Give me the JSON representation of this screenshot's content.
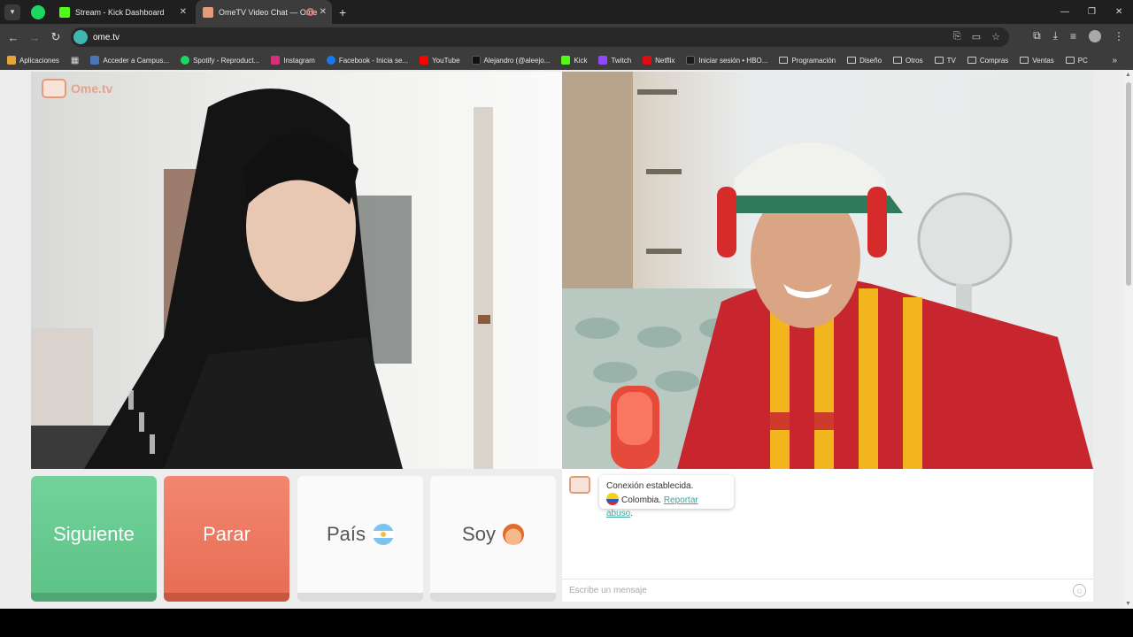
{
  "browser": {
    "tabs": [
      {
        "title": "Stream - Kick Dashboard",
        "icon": "kick-icon"
      },
      {
        "title": "OmeTV Video Chat — Ome",
        "icon": "ometv-icon"
      }
    ],
    "url": "ome.tv",
    "bookmarks": [
      {
        "label": "Aplicaciones",
        "icon": "apps-icon",
        "color": "#e8a33a"
      },
      {
        "label": "Acceder a Campus...",
        "icon": "campus-icon",
        "color": "#4a76b8"
      },
      {
        "label": "Spotify - Reproduct...",
        "icon": "spotify-icon",
        "color": "#1ed760"
      },
      {
        "label": "Instagram",
        "icon": "instagram-icon",
        "color": "#d6307a"
      },
      {
        "label": "Facebook - Inicia se...",
        "icon": "facebook-icon",
        "color": "#1877f2"
      },
      {
        "label": "YouTube",
        "icon": "youtube-icon",
        "color": "#ff0000"
      },
      {
        "label": "Alejandro (@aleejo...",
        "icon": "tiktok-icon",
        "color": "#111111"
      },
      {
        "label": "Kick",
        "icon": "kick-icon",
        "color": "#53fc18"
      },
      {
        "label": "Twitch",
        "icon": "twitch-icon",
        "color": "#9146ff"
      },
      {
        "label": "Netflix",
        "icon": "netflix-icon",
        "color": "#e50914"
      },
      {
        "label": "Iniciar sesión • HBO...",
        "icon": "hbo-icon",
        "color": "#1b1b1b"
      },
      {
        "label": "Programación",
        "icon": "folder-icon",
        "color": ""
      },
      {
        "label": "Diseño",
        "icon": "folder-icon",
        "color": ""
      },
      {
        "label": "Otros",
        "icon": "folder-icon",
        "color": ""
      },
      {
        "label": "TV",
        "icon": "folder-icon",
        "color": ""
      },
      {
        "label": "Compras",
        "icon": "folder-icon",
        "color": ""
      },
      {
        "label": "Ventas",
        "icon": "folder-icon",
        "color": ""
      },
      {
        "label": "PC",
        "icon": "folder-icon",
        "color": ""
      }
    ]
  },
  "app": {
    "logo_text": "Ome.tv",
    "buttons": {
      "next": "Siguiente",
      "stop": "Parar",
      "country": "País",
      "gender": "Soy"
    },
    "chat": {
      "status": "Conexión establecida.",
      "country": "Colombia.",
      "report": "Reportar abuso",
      "report_suffix": ".",
      "placeholder": "Escribe un mensaje"
    }
  },
  "colors": {
    "next": "#5dc386",
    "stop": "#e86e55",
    "link": "#3aa6a0"
  }
}
